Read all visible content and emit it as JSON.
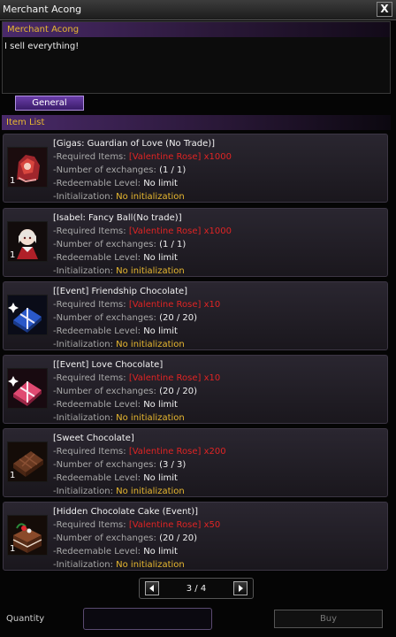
{
  "window": {
    "title": "Merchant Acong",
    "close_glyph": "X"
  },
  "npc": {
    "name": "Merchant Acong",
    "dialog": "I sell everything!"
  },
  "tabs": {
    "general": "General"
  },
  "item_list": {
    "header": "Item List",
    "required_label": "-Required Items:",
    "exchanges_label": "-Number of exchanges:",
    "level_label": "-Redeemable Level:",
    "init_label": "-Initialization:",
    "items": [
      {
        "name": "[Gigas: Guardian of Love (No Trade)]",
        "required": "[Valentine Rose] x1000",
        "exchanges": "(1 / 1)",
        "level": "No limit",
        "initialization": "No initialization",
        "count": "1",
        "icon": "gigas-armor-icon"
      },
      {
        "name": "[Isabel: Fancy Ball(No trade)]",
        "required": "[Valentine Rose] x1000",
        "exchanges": "(1 / 1)",
        "level": "No limit",
        "initialization": "No initialization",
        "count": "1",
        "icon": "isabel-doll-icon"
      },
      {
        "name": "[[Event] Friendship Chocolate]",
        "required": "[Valentine Rose] x10",
        "exchanges": "(20 / 20)",
        "level": "No limit",
        "initialization": "No initialization",
        "count": "",
        "icon": "blue-chocolate-box-icon"
      },
      {
        "name": "[[Event] Love Chocolate]",
        "required": "[Valentine Rose] x10",
        "exchanges": "(20 / 20)",
        "level": "No limit",
        "initialization": "No initialization",
        "count": "",
        "icon": "pink-chocolate-box-icon"
      },
      {
        "name": "[Sweet Chocolate]",
        "required": "[Valentine Rose] x200",
        "exchanges": "(3 / 3)",
        "level": "No limit",
        "initialization": "No initialization",
        "count": "1",
        "icon": "chocolate-bar-icon"
      },
      {
        "name": "[Hidden Chocolate Cake (Event)]",
        "required": "[Valentine Rose] x50",
        "exchanges": "(20 / 20)",
        "level": "No limit",
        "initialization": "No initialization",
        "count": "1",
        "icon": "chocolate-cake-icon"
      }
    ]
  },
  "pagination": {
    "text": "3 / 4"
  },
  "footer": {
    "quantity_label": "Quantity",
    "quantity_value": "",
    "buy_label": "Buy"
  },
  "colors": {
    "accent_purple": "#4a2a6a",
    "header_gold": "#e8b830",
    "required_red": "#e02424"
  }
}
